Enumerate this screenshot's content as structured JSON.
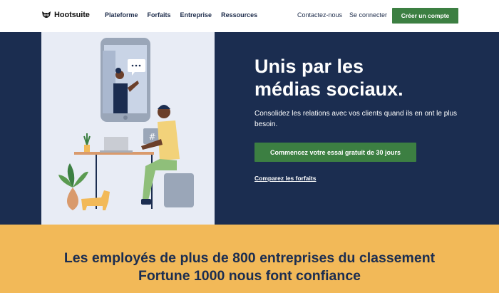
{
  "header": {
    "logo_text": "Hootsuite",
    "logo_icon": "owl-logo-icon",
    "nav": [
      {
        "label": "Plateforme"
      },
      {
        "label": "Forfaits"
      },
      {
        "label": "Entreprise"
      },
      {
        "label": "Ressources"
      }
    ],
    "contact_label": "Contactez-nous",
    "login_label": "Se connecter",
    "signup_label": "Créer un compte"
  },
  "hero": {
    "title_line1": "Unis par les",
    "title_line2": "médias sociaux.",
    "subtitle": "Consolidez les relations avec vos clients quand ils en ont le plus besoin.",
    "cta_label": "Commencez votre essai gratuit de 30 jours",
    "link_label": "Comparez les forfaits",
    "illustration_badge": "#"
  },
  "trust": {
    "line1": "Les employés de plus de 800 entreprises du classement",
    "line2": "Fortune 1000 nous font confiance"
  },
  "colors": {
    "navy": "#1b2d50",
    "green": "#3c7f42",
    "yellow": "#f2b958",
    "illustration_bg": "#e8ecf5"
  }
}
